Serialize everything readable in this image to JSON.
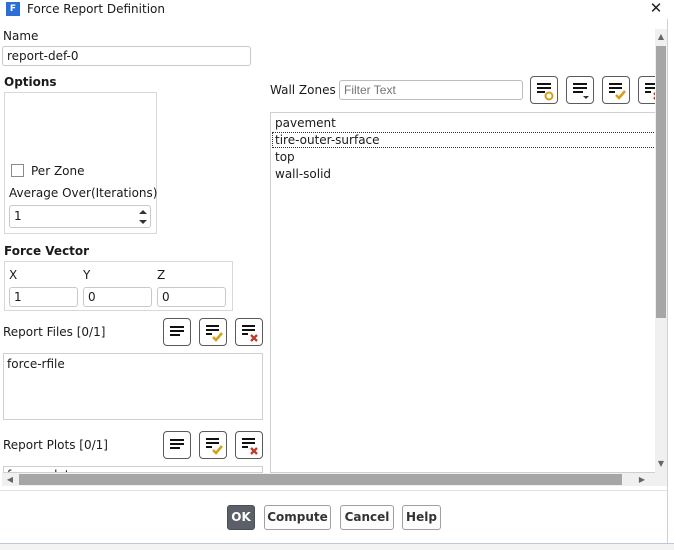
{
  "window": {
    "title": "Force Report Definition",
    "app_icon_letter": "F",
    "close_glyph": "✕"
  },
  "name_section": {
    "label": "Name",
    "value": "report-def-0"
  },
  "options": {
    "label": "Options",
    "per_zone_label": "Per Zone",
    "per_zone_checked": false,
    "average_over_label": "Average Over(Iterations)",
    "average_over_value": "1"
  },
  "force_vector": {
    "label": "Force Vector",
    "x_label": "X",
    "x_value": "1",
    "y_label": "Y",
    "y_value": "0",
    "z_label": "Z",
    "z_value": "0"
  },
  "report_files": {
    "label": "Report Files [0/1]",
    "items": [
      "force-rfile"
    ]
  },
  "report_plots": {
    "label": "Report Plots [0/1]",
    "items": [
      "force-rplot"
    ]
  },
  "wall_zones": {
    "label": "Wall Zones",
    "filter_placeholder": "Filter Text",
    "items": [
      "pavement",
      "tire-outer-surface",
      "top",
      "wall-solid"
    ]
  },
  "buttons": {
    "ok": "OK",
    "compute": "Compute",
    "cancel": "Cancel",
    "help": "Help"
  },
  "colors": {
    "accent": "#2b6fd6",
    "check_gold": "#d4a017",
    "deselect_red": "#c0392b",
    "ok_bg": "#5b6068"
  }
}
